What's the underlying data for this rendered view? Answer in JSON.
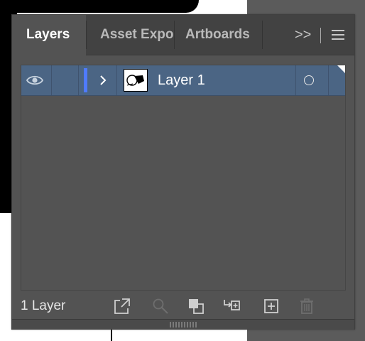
{
  "panel": {
    "tabs": [
      {
        "label": "Layers",
        "active": true
      },
      {
        "label": "Asset Expo",
        "active": false
      },
      {
        "label": "Artboards",
        "active": false
      }
    ],
    "overflow_label": ">>",
    "menu_icon": "hamburger-menu-icon"
  },
  "layers": [
    {
      "name": "Layer 1",
      "visible": true,
      "color": "#4f7bff",
      "selected_bg": "#4b6584",
      "icons": [
        "eye-icon",
        "chevron-right-icon",
        "target-circle-icon"
      ]
    }
  ],
  "footer": {
    "count_text": "1 Layer",
    "icons": [
      "export-icon",
      "search-icon",
      "clipping-mask-icon",
      "create-sublayer-icon",
      "new-layer-icon",
      "trash-icon"
    ]
  }
}
